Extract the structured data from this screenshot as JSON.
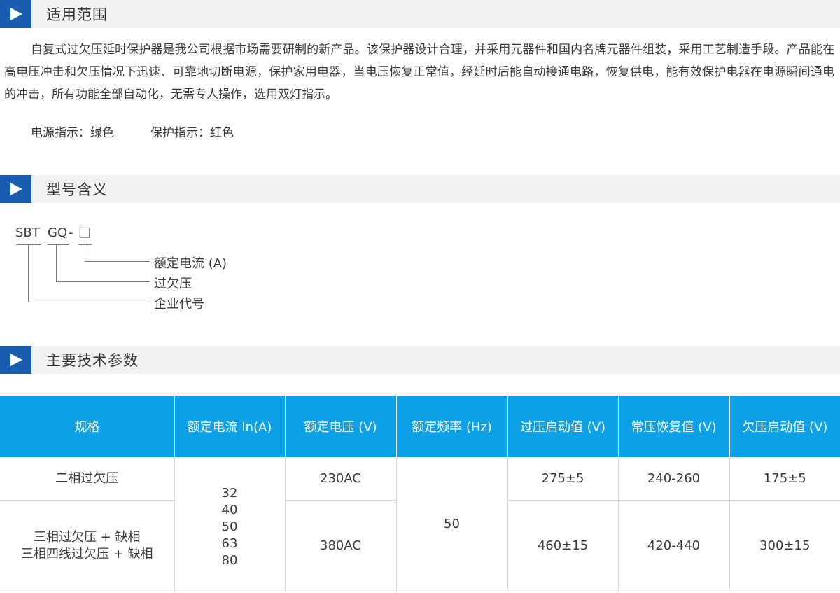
{
  "sections": {
    "scope": {
      "title": "适用范围"
    },
    "model": {
      "title": "型号含义"
    },
    "params": {
      "title": "主要技术参数"
    }
  },
  "scope": {
    "paragraph": "自复式过欠压延时保护器是我公司根据市场需要研制的新产品。该保护器设计合理，并采用元器件和国内名牌元器件组装，采用工艺制造手段。产品能在高电压冲击和欠压情况下迅速、可靠地切断电源，保护家用电器，当电压恢复正常值，经延时后能自动接通电路，恢复供电，能有效保护电器在电源瞬间通电的冲击，所有功能全部自动化，无需专人操作，选用双灯指示。",
    "power_indicator": "电源指示：绿色",
    "protect_indicator": "保护指示：红色"
  },
  "model": {
    "part1": "SBT",
    "part2": "GQ",
    "dash": "-",
    "box": "□",
    "labels": [
      "额定电流 (A)",
      "过欠压",
      "企业代号"
    ]
  },
  "table": {
    "headers": [
      "规格",
      "额定电流 In(A)",
      "额定电压 (V)",
      "额定频率 (Hz)",
      "过压启动值 (V)",
      "常压恢复值 (V)",
      "欠压启动值 (V)"
    ],
    "row1": {
      "spec": "二相过欠压",
      "voltage": "230AC",
      "over": "275±5",
      "recover": "240-260",
      "under": "175±5"
    },
    "row2": {
      "spec_lines": [
        "三相过欠压 + 缺相",
        "三相四线过欠压 + 缺相"
      ],
      "voltage": "380AC",
      "over": "460±15",
      "recover": "420-440",
      "under": "300±15"
    },
    "currents": [
      "32",
      "40",
      "50",
      "63",
      "80"
    ],
    "frequency": "50"
  }
}
